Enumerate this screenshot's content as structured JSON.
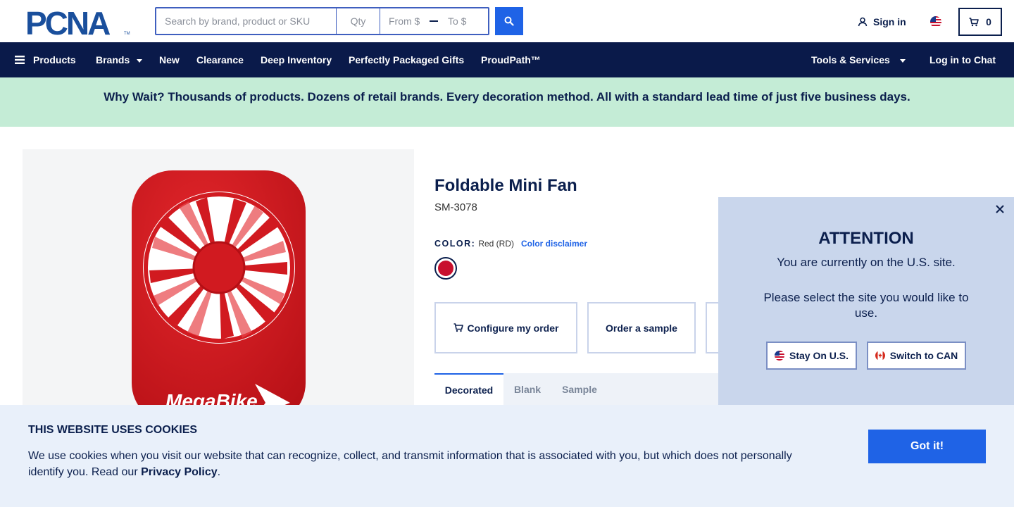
{
  "header": {
    "logo_text": "PCNA",
    "search": {
      "keyword_placeholder": "Search by brand, product or SKU",
      "qty_placeholder": "Qty",
      "from_placeholder": "From $",
      "to_placeholder": "To $"
    },
    "sign_in": "Sign in",
    "cart_count": "0"
  },
  "nav": {
    "products": "Products",
    "brands": "Brands",
    "new": "New",
    "clearance": "Clearance",
    "deep_inventory": "Deep Inventory",
    "gifts": "Perfectly Packaged Gifts",
    "proudpath": "ProudPath™",
    "tools": "Tools & Services",
    "chat": "Log in to Chat"
  },
  "promo": {
    "text": "Why Wait? Thousands of products. Dozens of retail brands. Every decoration method. All with a standard lead time of just five business days."
  },
  "product": {
    "title": "Foldable Mini Fan",
    "sku": "SM-3078",
    "color_label": "COLOR:",
    "color_value": "Red (RD)",
    "color_disclaimer": "Color disclaimer",
    "swatch_color": "#c8102e",
    "image_brand_text": "MegaBike",
    "actions": {
      "configure": "Configure my order",
      "sample": "Order a sample"
    },
    "tabs": [
      "Decorated",
      "Blank",
      "Sample"
    ]
  },
  "site_modal": {
    "heading": "ATTENTION",
    "line1": "You are currently on the U.S. site.",
    "line2": "Please select the site you would like to use.",
    "stay_button": "Stay On U.S.",
    "switch_button": "Switch to CAN"
  },
  "cookie_banner": {
    "heading": "THIS WEBSITE USES COOKIES",
    "body": "We use cookies when you visit our website that can recognize, collect, and transmit information that is associated with you, but which does not personally identify you. Read our ",
    "link": "Privacy Policy",
    "end": ".",
    "button": "Got it!"
  },
  "colors": {
    "navy": "#0a1a4a",
    "accent_blue": "#1f63e6",
    "promo_green": "#c4ecd6",
    "product_red": "#c8102e"
  }
}
